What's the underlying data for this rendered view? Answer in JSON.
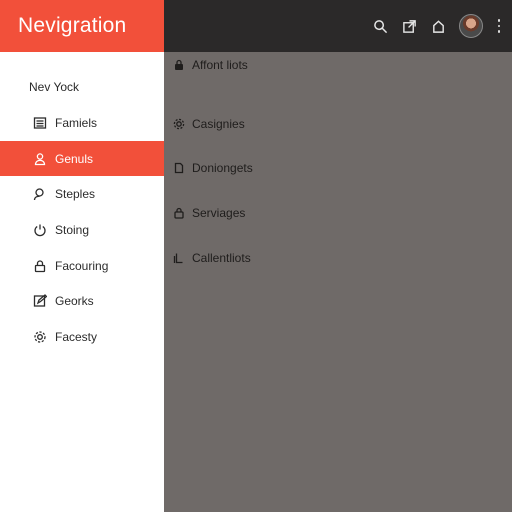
{
  "drawer": {
    "title": "Nevigration",
    "section_label": "Nev Yock",
    "items": [
      {
        "label": "Famiels",
        "icon": "list-icon",
        "active": false
      },
      {
        "label": "Genuls",
        "icon": "person-icon",
        "active": true
      },
      {
        "label": "Steples",
        "icon": "user-icon",
        "active": false
      },
      {
        "label": "Stoing",
        "icon": "power-icon",
        "active": false
      },
      {
        "label": "Facouring",
        "icon": "lock-icon",
        "active": false
      },
      {
        "label": "Georks",
        "icon": "edit-icon",
        "active": false
      },
      {
        "label": "Facesty",
        "icon": "gear-icon",
        "active": false
      }
    ]
  },
  "appbar": {
    "actions": [
      "search-icon",
      "open-in-new-icon",
      "home-icon",
      "avatar",
      "more-vert-icon"
    ]
  },
  "content": {
    "items": [
      {
        "label": "Affont liots",
        "icon": "lock-icon"
      },
      {
        "label": "Casignies",
        "icon": "gear-icon"
      },
      {
        "label": "Doniongets",
        "icon": "document-icon"
      },
      {
        "label": "Serviages",
        "icon": "lock-icon"
      },
      {
        "label": "Callentliots",
        "icon": "copy-icon"
      }
    ]
  },
  "colors": {
    "accent": "#f2503a",
    "appbar": "#2b2929",
    "scrim": "#6f6a68",
    "drawer_bg": "#ffffff"
  }
}
